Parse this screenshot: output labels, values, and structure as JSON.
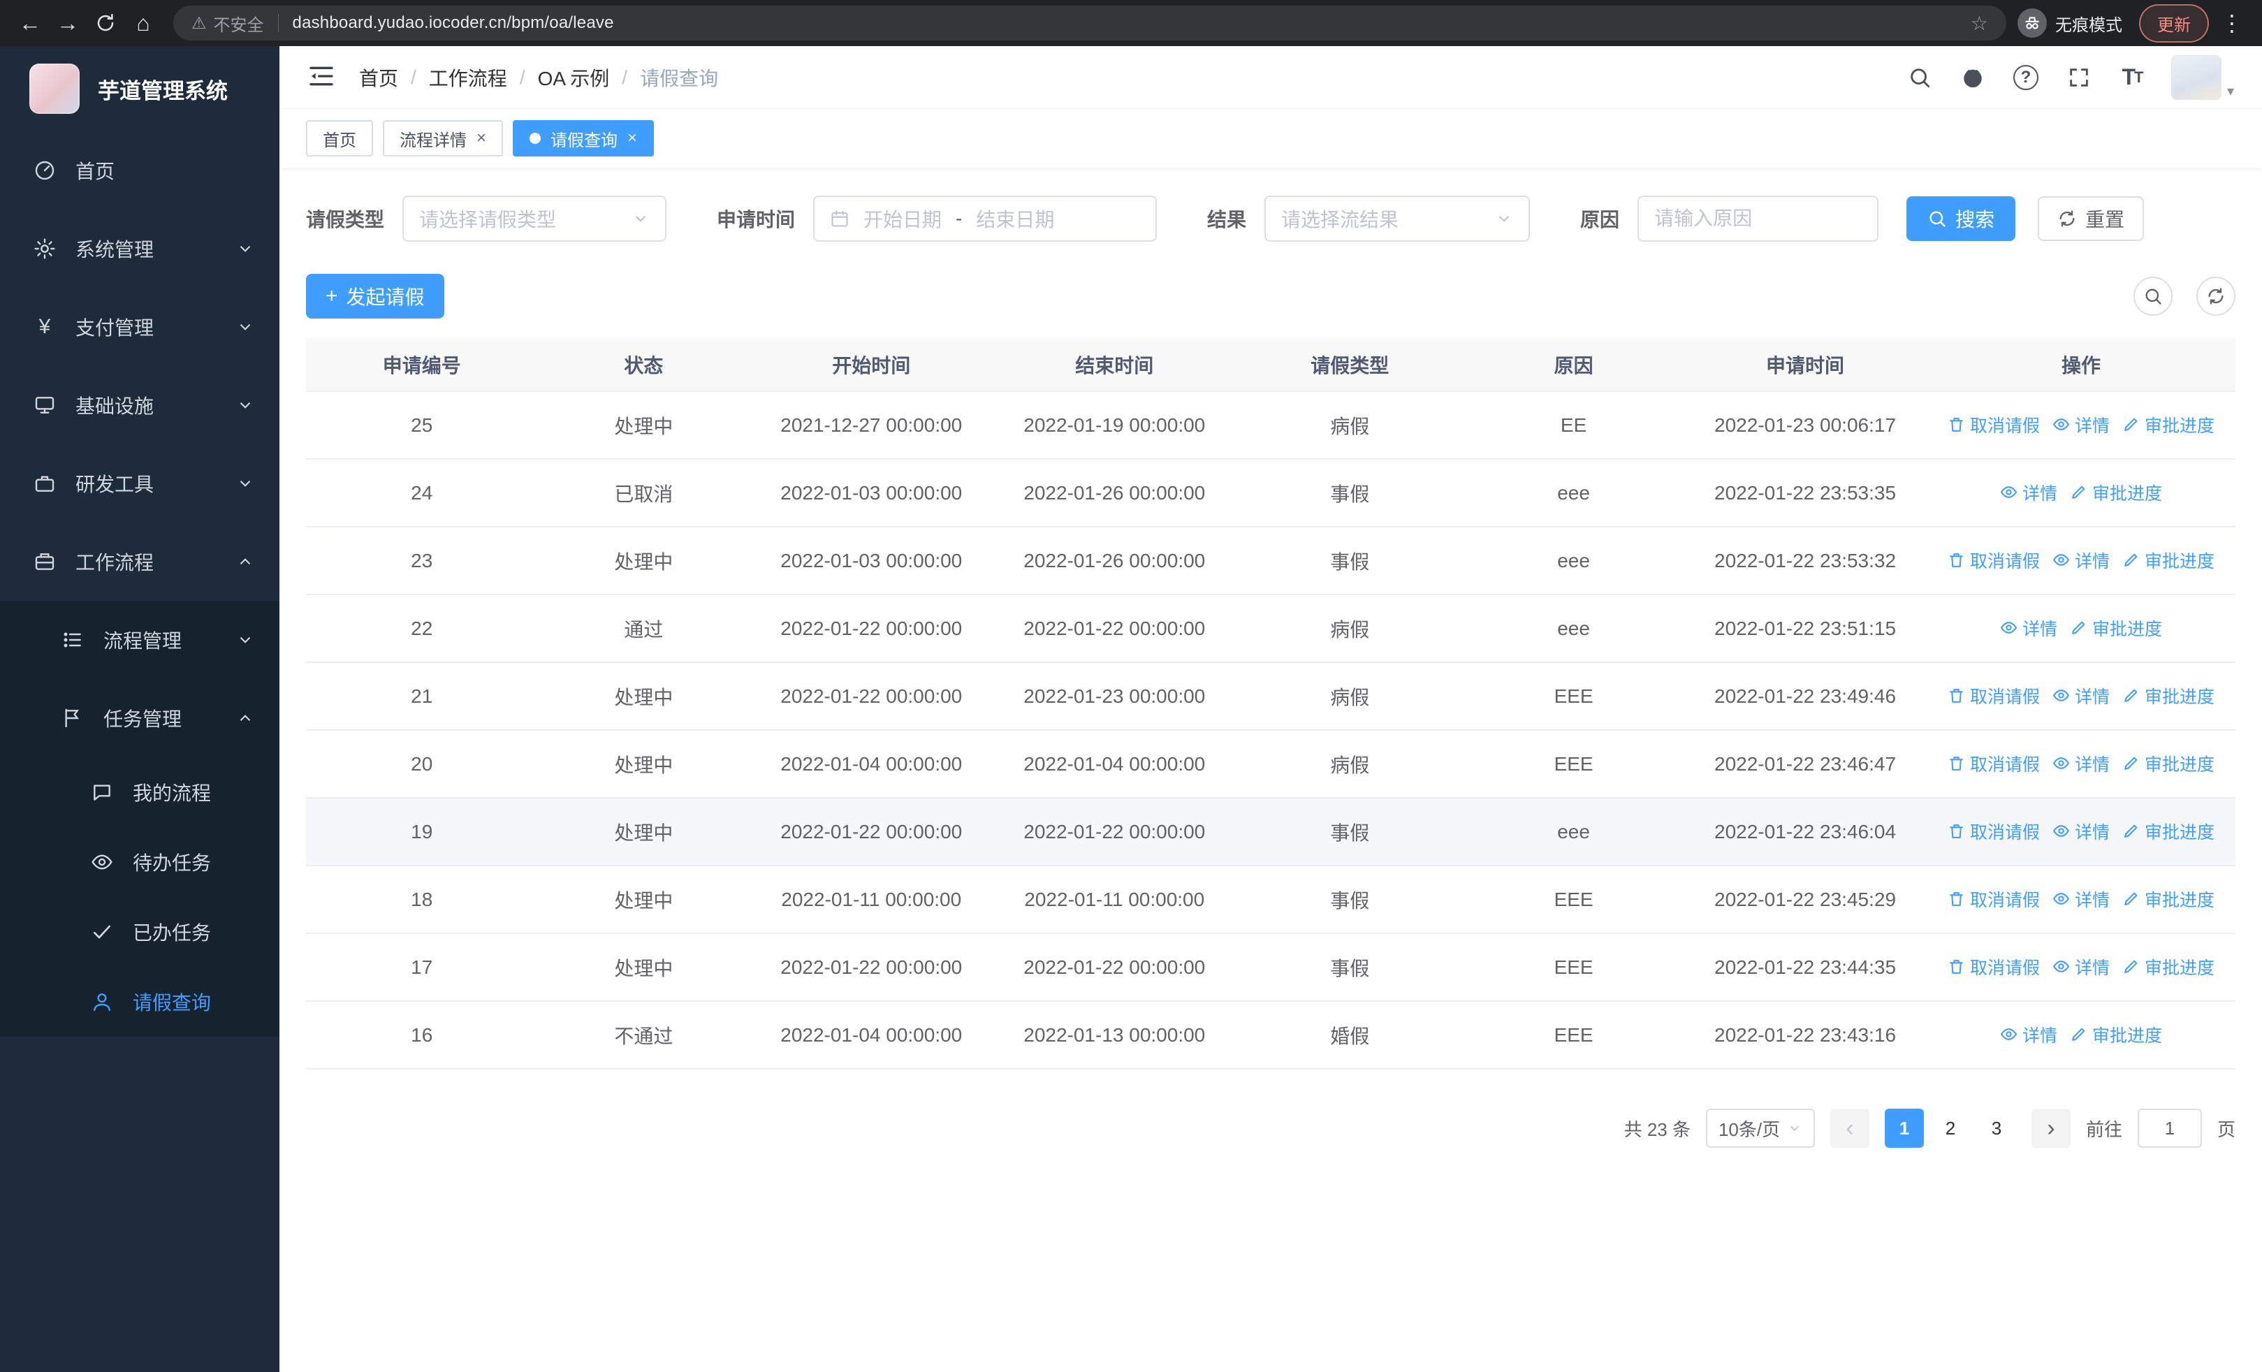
{
  "colors": {
    "primary": "#409eff",
    "sidebar_bg": "#1d2b3a",
    "sidebar_submenu_bg": "#16222e"
  },
  "browser": {
    "security_label": "不安全",
    "url": "dashboard.yudao.iocoder.cn/bpm/oa/leave",
    "incognito_label": "无痕模式",
    "update_label": "更新"
  },
  "sidebar": {
    "title": "芋道管理系统",
    "items": [
      {
        "label": "首页"
      },
      {
        "label": "系统管理"
      },
      {
        "label": "支付管理"
      },
      {
        "label": "基础设施"
      },
      {
        "label": "研发工具"
      },
      {
        "label": "工作流程"
      },
      {
        "label": "流程管理"
      },
      {
        "label": "任务管理"
      },
      {
        "label": "我的流程"
      },
      {
        "label": "待办任务"
      },
      {
        "label": "已办任务"
      },
      {
        "label": "请假查询"
      }
    ]
  },
  "header": {
    "breadcrumb": [
      "首页",
      "工作流程",
      "OA 示例",
      "请假查询"
    ],
    "separator": "/"
  },
  "tabs": [
    {
      "label": "首页"
    },
    {
      "label": "流程详情"
    },
    {
      "label": "请假查询"
    }
  ],
  "filters": {
    "type_label": "请假类型",
    "type_placeholder": "请选择请假类型",
    "time_label": "申请时间",
    "start_placeholder": "开始日期",
    "range_separator": "-",
    "end_placeholder": "结束日期",
    "result_label": "结果",
    "result_placeholder": "请选择流结果",
    "reason_label": "原因",
    "reason_placeholder": "请输入原因",
    "search_label": "搜索",
    "reset_label": "重置"
  },
  "toolbar": {
    "create_label": "发起请假"
  },
  "table": {
    "columns": [
      "申请编号",
      "状态",
      "开始时间",
      "结束时间",
      "请假类型",
      "原因",
      "申请时间",
      "操作"
    ],
    "action_labels": {
      "cancel": "取消请假",
      "detail": "详情",
      "progress": "审批进度"
    },
    "highlighted_id": "19",
    "rows": [
      {
        "id": "25",
        "status": "处理中",
        "start": "2021-12-27 00:00:00",
        "end": "2022-01-19 00:00:00",
        "type": "病假",
        "reason": "EE",
        "applied": "2022-01-23 00:06:17",
        "actions": [
          "cancel",
          "detail",
          "progress"
        ]
      },
      {
        "id": "24",
        "status": "已取消",
        "start": "2022-01-03 00:00:00",
        "end": "2022-01-26 00:00:00",
        "type": "事假",
        "reason": "eee",
        "applied": "2022-01-22 23:53:35",
        "actions": [
          "detail",
          "progress"
        ]
      },
      {
        "id": "23",
        "status": "处理中",
        "start": "2022-01-03 00:00:00",
        "end": "2022-01-26 00:00:00",
        "type": "事假",
        "reason": "eee",
        "applied": "2022-01-22 23:53:32",
        "actions": [
          "cancel",
          "detail",
          "progress"
        ]
      },
      {
        "id": "22",
        "status": "通过",
        "start": "2022-01-22 00:00:00",
        "end": "2022-01-22 00:00:00",
        "type": "病假",
        "reason": "eee",
        "applied": "2022-01-22 23:51:15",
        "actions": [
          "detail",
          "progress"
        ]
      },
      {
        "id": "21",
        "status": "处理中",
        "start": "2022-01-22 00:00:00",
        "end": "2022-01-23 00:00:00",
        "type": "病假",
        "reason": "EEE",
        "applied": "2022-01-22 23:49:46",
        "actions": [
          "cancel",
          "detail",
          "progress"
        ]
      },
      {
        "id": "20",
        "status": "处理中",
        "start": "2022-01-04 00:00:00",
        "end": "2022-01-04 00:00:00",
        "type": "病假",
        "reason": "EEE",
        "applied": "2022-01-22 23:46:47",
        "actions": [
          "cancel",
          "detail",
          "progress"
        ]
      },
      {
        "id": "19",
        "status": "处理中",
        "start": "2022-01-22 00:00:00",
        "end": "2022-01-22 00:00:00",
        "type": "事假",
        "reason": "eee",
        "applied": "2022-01-22 23:46:04",
        "actions": [
          "cancel",
          "detail",
          "progress"
        ]
      },
      {
        "id": "18",
        "status": "处理中",
        "start": "2022-01-11 00:00:00",
        "end": "2022-01-11 00:00:00",
        "type": "事假",
        "reason": "EEE",
        "applied": "2022-01-22 23:45:29",
        "actions": [
          "cancel",
          "detail",
          "progress"
        ]
      },
      {
        "id": "17",
        "status": "处理中",
        "start": "2022-01-22 00:00:00",
        "end": "2022-01-22 00:00:00",
        "type": "事假",
        "reason": "EEE",
        "applied": "2022-01-22 23:44:35",
        "actions": [
          "cancel",
          "detail",
          "progress"
        ]
      },
      {
        "id": "16",
        "status": "不通过",
        "start": "2022-01-04 00:00:00",
        "end": "2022-01-13 00:00:00",
        "type": "婚假",
        "reason": "EEE",
        "applied": "2022-01-22 23:43:16",
        "actions": [
          "detail",
          "progress"
        ]
      }
    ]
  },
  "pagination": {
    "total": "共 23 条",
    "page_size": "10条/页",
    "pages": [
      "1",
      "2",
      "3"
    ],
    "active_page": "1",
    "goto_label": "前往",
    "goto_value": "1",
    "unit_label": "页"
  }
}
